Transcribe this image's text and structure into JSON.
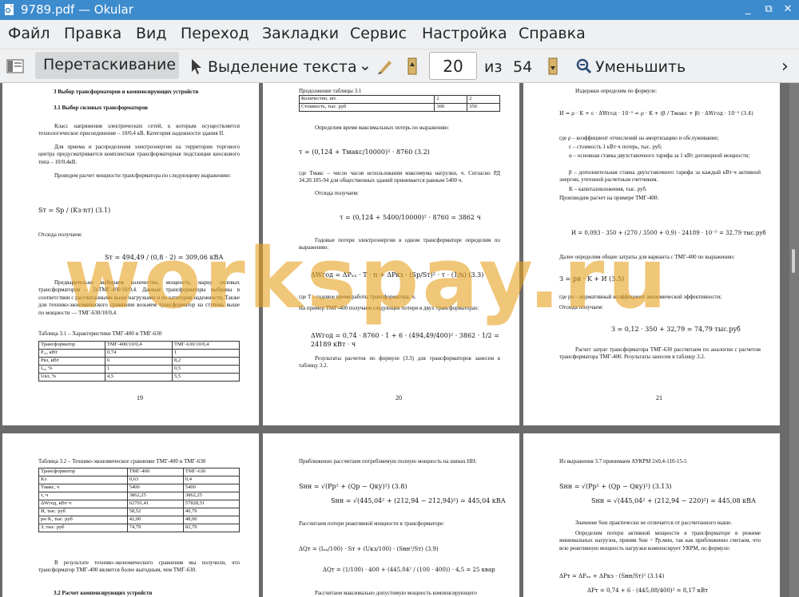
{
  "window": {
    "title": "9789.pdf — Okular",
    "minimize": "_",
    "maximize": "⧉",
    "close": "✕"
  },
  "menu": [
    "Файл",
    "Правка",
    "Вид",
    "Переход",
    "Закладки",
    "Сервис",
    "Настройка",
    "Справка"
  ],
  "toolbar": {
    "drag_label": "Перетаскивание",
    "select_label": "Выделение текста",
    "dropdown": "⌄",
    "page_current": "20",
    "page_of": "из",
    "page_total": "54",
    "zoom_out_label": "Уменьшить",
    "more": "›"
  },
  "watermark": "workspay.ru",
  "pages": {
    "p19": {
      "h1": "3 Выбор трансформаторов и компенсирующих устройств",
      "h2": "3.1 Выбор силовых трансформаторов",
      "t1": "Класс напряжения электрических сетей, к которым осуществляется технологическое присоединение – 10/0,4 кВ. Категория надежности здания II.",
      "t2": "Для приема и распределения электроэнергии на территории торгового центра предусматривается комплектная трансформаторная подстанция киоскового типа – 10/0,4кВ.",
      "t3": "Проведем расчет мощности трансформатора по следующему выражению:",
      "f1": "Sт = Sр / (Kз·nт)  (3.1)",
      "t4": "Отсюда получаем:",
      "f2": "Sт = 494,49 / (0,8 · 2) = 309,06 кВА",
      "t5": "Предварительно выбираем количество, мощность, марку силовых трансформаторов – 2хТМГ-400/10/0,4. Данные трансформаторы выбраны в соответствии с рассчитанными выше нагрузками и по категории надежности. Также для технико-экономического сравнения возьмем трансформатор на ступень выше по мощности — ТМГ-630/10/0,4.",
      "caption": "Таблица 3.1 – Характеристики ТМГ-400 и ТМГ-630",
      "table": [
        [
          "Трансформатор",
          "ТМГ-400/10/0,4",
          "ТМГ-630/10/0,4"
        ],
        [
          "Pₓₓ, кВт",
          "0,74",
          "1"
        ],
        [
          "Pкз, кВт",
          "6",
          "8,2"
        ],
        [
          "Iₓₓ, %",
          "1",
          "0,5"
        ],
        [
          "Uкз, %",
          "4,5",
          "5,5"
        ]
      ],
      "num": "19"
    },
    "p20": {
      "cont": "Продолжение таблицы 3.1",
      "table": [
        [
          "Количество, шт.",
          "2",
          "2"
        ],
        [
          "Стоимость, тыс. руб",
          "300",
          "350"
        ]
      ],
      "t1": "Определим время максимальных потерь по выражению:",
      "f1": "τ = (0,124 + Tмакс/10000)² · 8760          (3.2)",
      "t2": "где Tмакс – число часов использования максимума нагрузки, ч. Согласно РД 34.20.185-94 для общественных зданий принимается равным 5400 ч.",
      "t3": "Отсюда получаем:",
      "f2": "τ = (0,124 + 5400/10000)² · 8760 = 3862 ч",
      "t4": "Годовые потери электроэнергии в одном трансформаторе определим по выражению:",
      "f3": "ΔWгод = ΔPₓₓ · T · n + ΔPкз · (Sр/Sт)² · τ · (1/n)  (3.3)",
      "t5": "где T – годовое время работы трансформатора, ч.",
      "t6": "На пример ТМГ-400 получаем следующие потери в двух трансформаторах:",
      "f4": "ΔWгод = 0,74 · 8760 · 1 + 6 · (494,49/400)² · 3862 · 1/2 = 24189 кВт · ч",
      "t7": "Результаты расчетов по формуле (3.3) для трансформаторов занесем в таблицу 3.2.",
      "num": "20"
    },
    "p21": {
      "t1": "Издержки определим по формуле:",
      "f1": "И = ρ · K + ε · ΔWгод · 10⁻⁵ = ρ · K + (β / Tмакс + β) · ΔWгод · 10⁻⁵ (3.4)",
      "t2": "где ρ – коэффициент отчислений на амортизацию и обслуживание;",
      "t3": "ε – стоимость 1 кВт·ч потерь, тыс. руб;",
      "t4": "α – основная ставка двухставочного тарифа за 1 кВт договорной мощности;",
      "t5": "β – дополнительная ставка двухставочного тарифа за каждый кВт·ч активной энергии, учтенной расчетным счетчиком.",
      "t6": "K – капиталовложения, тыс. руб.",
      "t7": "Производим расчет на примере ТМГ-400:",
      "f2": "И = 0,093 · 350 + (270 / 3500 + 0,9) · 24189 · 10⁻⁵ = 32,79 тыс.руб",
      "t8": "Далее определим общие затраты для варианта с ТМГ-400 по выражению:",
      "f3": "З = pн · K + И   (3.5)",
      "t9": "где pн – нормативный коэффициент экономической эффективности;",
      "t10": "Отсюда получаем:",
      "f4": "З = 0,12 · 350 + 32,79 = 74,79 тыс.руб",
      "t11": "Расчет затрат трансформатора ТМГ-630 рассчитаем по аналогии с расчетом трансформатора ТМГ-400. Результаты занесем в таблицу 3.2.",
      "num": "21"
    },
    "p22": {
      "caption": "Таблица 3.2 – Технико-экономическое сравнение ТМГ-400 и ТМГ-630",
      "table": [
        [
          "Трансформатор",
          "ТМГ-400",
          "ТМГ-630"
        ],
        [
          "Kз",
          "0,63",
          "0,4"
        ],
        [
          "Tмакс, ч",
          "5400",
          "5400"
        ],
        [
          "τ, ч",
          "3862,25",
          "3862,25"
        ],
        [
          "ΔWгод, кВт·ч",
          "62791,41",
          "57828,51"
        ],
        [
          "И, тыс. руб",
          "58,52",
          "40,79"
        ],
        [
          "pн·K, тыс. руб",
          "42,00",
          "48,00"
        ],
        [
          "З, тыс. руб",
          "74,79",
          "82,79"
        ]
      ],
      "t1": "В результате технико-экономического сравнения мы получили, что трансформатор ТМГ-400 является более выгодным, чем ТМГ-630.",
      "h2": "3.2 Расчет компенсирующих устройств"
    },
    "p23": {
      "t1": "Приближенно рассчитаем потребляемую полную мощность на шинах НН:",
      "f1": "Sнн = √(Pр² + (Qр − Qку)²)   (3.8)",
      "f2": "Sнн = √(445,04² + (212,94 − 212,94)²) = 445,04 кВА",
      "t2": "Рассчитаем потери реактивной мощности в трансформаторе:",
      "f3": "ΔQт = (Iₓₓ/100) · Sт + (Uкз/100) · (Sнн²/Sт)     (3.9)",
      "f4": "ΔQт = (1/100) · 400 + (445,04² / (100 · 400)) · 4,5 = 25 квар",
      "t3": "Рассчитаем максимально допустимую мощность компенсирующего"
    },
    "p24": {
      "t1": "Из выражения 3.7 принимаем АУКРМ 2х0,4-110-15-5",
      "f1": "Sнн = √(Pр² + (Qр − Qку)²)   (3.13)",
      "f2": "Sнн = √(445,04² + (212,94 − 220)²) = 445,08 кВА",
      "t2": "Значение Sнн практически не отличается от рассчитанного выше.",
      "t3": "Определим потери активной мощности в трансформаторе в режиме минимальных нагрузок, приняв Sнн = Pр.мин, так как приближенно считаем, что всю реактивную мощность нагрузки компенсирует УКРМ, по формуле:",
      "f3": "ΔPт = ΔPₓₓ + ΔPкз · (Sнн/Sт)²   (3.14)",
      "f4": "ΔPт = 0,74 + 6 · (445,08/400)² = 8,17 кВт"
    }
  }
}
